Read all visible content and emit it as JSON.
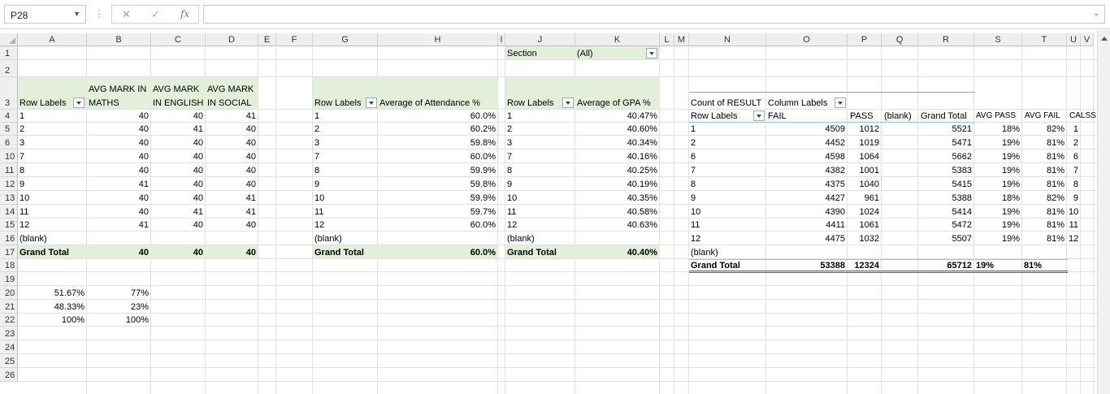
{
  "namebox": {
    "value": "P28"
  },
  "formula": {
    "cancel": "✕",
    "enter": "✓",
    "fx": "fx",
    "content": ""
  },
  "columns": [
    "A",
    "B",
    "C",
    "D",
    "E",
    "F",
    "G",
    "H",
    "I",
    "J",
    "K",
    "L",
    "M",
    "N",
    "O",
    "P",
    "Q",
    "R",
    "S",
    "T",
    "U",
    "V"
  ],
  "rows": [
    "1",
    "2",
    "3",
    "4",
    "5",
    "6",
    "10",
    "11",
    "12",
    "13",
    "14",
    "15",
    "16",
    "17",
    "18",
    "19",
    "20",
    "21",
    "22",
    "23",
    "24",
    "25",
    "26"
  ],
  "pivot1": {
    "row_labels": "Row Labels",
    "headers": [
      "AVG MARK IN",
      "MATHS",
      "AVG MARK",
      "IN ENGLISH",
      "AVG MARK",
      "IN SOCIAL"
    ],
    "rows": [
      {
        "label": "1",
        "maths": "40",
        "english": "40",
        "social": "41"
      },
      {
        "label": "2",
        "maths": "40",
        "english": "41",
        "social": "40"
      },
      {
        "label": "3",
        "maths": "40",
        "english": "40",
        "social": "40"
      },
      {
        "label": "7",
        "maths": "40",
        "english": "40",
        "social": "40"
      },
      {
        "label": "8",
        "maths": "40",
        "english": "40",
        "social": "40"
      },
      {
        "label": "9",
        "maths": "41",
        "english": "40",
        "social": "40"
      },
      {
        "label": "10",
        "maths": "40",
        "english": "40",
        "social": "41"
      },
      {
        "label": "11",
        "maths": "40",
        "english": "41",
        "social": "41"
      },
      {
        "label": "12",
        "maths": "41",
        "english": "40",
        "social": "40"
      },
      {
        "label": "(blank)",
        "maths": "",
        "english": "",
        "social": ""
      }
    ],
    "total": {
      "label": "Grand Total",
      "maths": "40",
      "english": "40",
      "social": "40"
    }
  },
  "pivot2": {
    "row_labels": "Row Labels",
    "header": "Average of Attendance %",
    "rows": [
      {
        "label": "1",
        "value": "60.0%"
      },
      {
        "label": "2",
        "value": "60.2%"
      },
      {
        "label": "3",
        "value": "59.8%"
      },
      {
        "label": "7",
        "value": "60.0%"
      },
      {
        "label": "8",
        "value": "59.9%"
      },
      {
        "label": "9",
        "value": "59.8%"
      },
      {
        "label": "10",
        "value": "59.9%"
      },
      {
        "label": "11",
        "value": "59.7%"
      },
      {
        "label": "12",
        "value": "60.0%"
      },
      {
        "label": "(blank)",
        "value": ""
      }
    ],
    "total": {
      "label": "Grand Total",
      "value": "60.0%"
    }
  },
  "pivot3": {
    "filter_label": "Section",
    "filter_value": "(All)",
    "row_labels": "Row Labels",
    "header": "Average of GPA %",
    "rows": [
      {
        "label": "1",
        "value": "40.47%"
      },
      {
        "label": "2",
        "value": "40.60%"
      },
      {
        "label": "3",
        "value": "40.34%"
      },
      {
        "label": "7",
        "value": "40.16%"
      },
      {
        "label": "8",
        "value": "40.25%"
      },
      {
        "label": "9",
        "value": "40.19%"
      },
      {
        "label": "10",
        "value": "40.35%"
      },
      {
        "label": "11",
        "value": "40.58%"
      },
      {
        "label": "12",
        "value": "40.63%"
      },
      {
        "label": "(blank)",
        "value": ""
      }
    ],
    "total": {
      "label": "Grand Total",
      "value": "40.40%"
    }
  },
  "pivot4": {
    "count_label": "Count of RESULT",
    "column_labels": "Column Labels",
    "row_labels": "Row Labels",
    "fail": "FAIL",
    "pass": "PASS",
    "blank": "(blank)",
    "grand_total": "Grand Total",
    "avg_pass": "AVG PASS",
    "avg_fail": "AVG FAIL",
    "calss": "CALSS",
    "rows": [
      {
        "label": "1",
        "fail": "4509",
        "pass": "1012",
        "total": "5521",
        "avgpass": "18%",
        "avgfail": "82%",
        "calss": "1"
      },
      {
        "label": "2",
        "fail": "4452",
        "pass": "1019",
        "total": "5471",
        "avgpass": "19%",
        "avgfail": "81%",
        "calss": "2"
      },
      {
        "label": "6",
        "fail": "4598",
        "pass": "1064",
        "total": "5662",
        "avgpass": "19%",
        "avgfail": "81%",
        "calss": "6"
      },
      {
        "label": "7",
        "fail": "4382",
        "pass": "1001",
        "total": "5383",
        "avgpass": "19%",
        "avgfail": "81%",
        "calss": "7"
      },
      {
        "label": "8",
        "fail": "4375",
        "pass": "1040",
        "total": "5415",
        "avgpass": "19%",
        "avgfail": "81%",
        "calss": "8"
      },
      {
        "label": "9",
        "fail": "4427",
        "pass": "961",
        "total": "5388",
        "avgpass": "18%",
        "avgfail": "82%",
        "calss": "9"
      },
      {
        "label": "10",
        "fail": "4390",
        "pass": "1024",
        "total": "5414",
        "avgpass": "19%",
        "avgfail": "81%",
        "calss": "10"
      },
      {
        "label": "11",
        "fail": "4411",
        "pass": "1061",
        "total": "5472",
        "avgpass": "19%",
        "avgfail": "81%",
        "calss": "11"
      },
      {
        "label": "12",
        "fail": "4475",
        "pass": "1032",
        "total": "5507",
        "avgpass": "19%",
        "avgfail": "81%",
        "calss": "12"
      },
      {
        "label": "(blank)",
        "fail": "",
        "pass": "",
        "total": "",
        "avgpass": "",
        "avgfail": "",
        "calss": ""
      }
    ],
    "total": {
      "label": "Grand Total",
      "fail": "53388",
      "pass": "12324",
      "total": "65712",
      "avgpass": "19%",
      "avgfail": "81%"
    }
  },
  "summary": [
    {
      "a": "51.67%",
      "b": "77%"
    },
    {
      "a": "48.33%",
      "b": "23%"
    },
    {
      "a": "100%",
      "b": "100%"
    }
  ],
  "colors": {
    "pivot_header": "#e2efda",
    "gridline": "#e1e1e1",
    "header_bg": "#efefef"
  }
}
